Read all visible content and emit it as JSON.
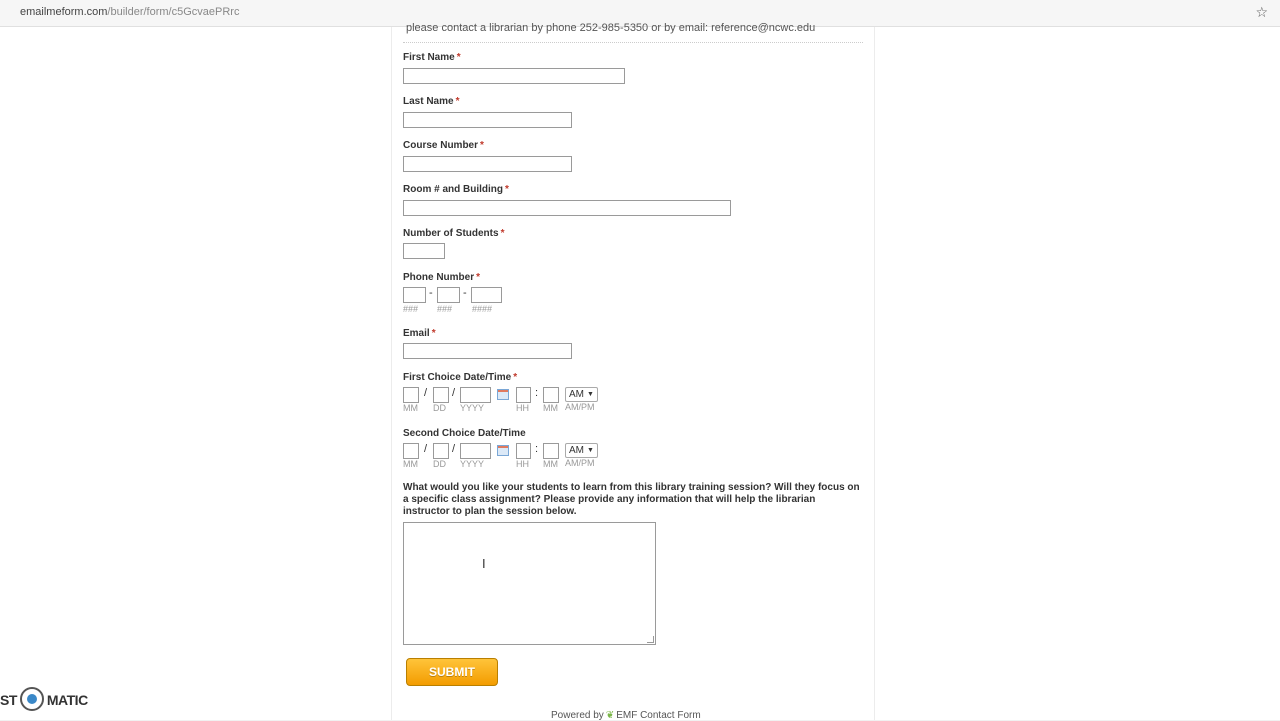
{
  "browser": {
    "url_domain": "emailmeform.com",
    "url_path": "/builder/form/c5GcvaePRrc"
  },
  "form": {
    "notice": "please contact a librarian by phone 252-985-5350 or by email: reference@ncwc.edu",
    "required_mark": "*",
    "first_name": {
      "label": "First Name"
    },
    "last_name": {
      "label": "Last Name"
    },
    "course_number": {
      "label": "Course Number"
    },
    "room_building": {
      "label": "Room # and Building"
    },
    "num_students": {
      "label": "Number of Students"
    },
    "phone": {
      "label": "Phone Number",
      "dash": "-",
      "sub1": "###",
      "sub2": "###",
      "sub3": "####"
    },
    "email": {
      "label": "Email"
    },
    "datetime_subs": {
      "mm": "MM",
      "dd": "DD",
      "yyyy": "YYYY",
      "hh": "HH",
      "min": "MM",
      "ampm": "AM/PM",
      "slash": "/",
      "colon": ":"
    },
    "first_choice": {
      "label": "First Choice Date/Time",
      "ampm_value": "AM"
    },
    "second_choice": {
      "label": "Second Choice Date/Time",
      "ampm_value": "AM"
    },
    "question": "What would you like your students to learn from this library training session? Will they focus on a specific class assignment? Please provide any information that will help the librarian instructor to plan the session below.",
    "submit_label": "SUBMIT",
    "powered_prefix": "Powered by",
    "powered_brand": "EMF Contact Form"
  },
  "watermark": {
    "left": "ST",
    "right": "MATIC"
  },
  "icons": {
    "star": "star-icon",
    "calendar": "calendar-icon",
    "text_cursor": "text-cursor-icon",
    "leaf": "emf-leaf-icon",
    "dropdown": "chevron-down-icon"
  },
  "colors": {
    "required": "#c0392b",
    "submit_top": "#ffc43a",
    "submit_bottom": "#f39c00"
  }
}
